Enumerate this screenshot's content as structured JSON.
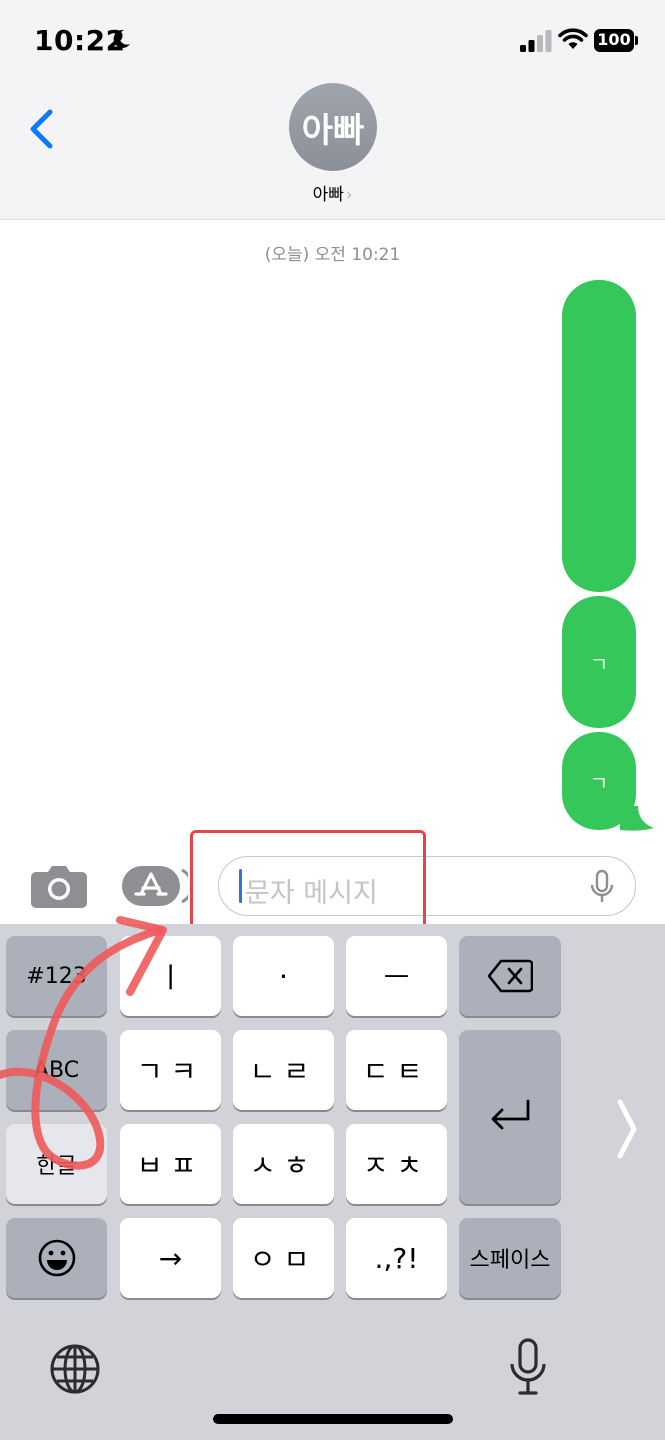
{
  "status_bar": {
    "time": "10:22",
    "battery": "100"
  },
  "header": {
    "avatar_text": "아빠",
    "contact_name": "아빠",
    "chevron": "›"
  },
  "conversation": {
    "timestamp": "(오늘) 오전 10:21",
    "messages": [
      {
        "text": "",
        "color": "#35c759"
      },
      {
        "text": "ㄱ",
        "color": "#35c759"
      },
      {
        "text": "ㄱ",
        "color": "#35c759"
      }
    ]
  },
  "input_bar": {
    "placeholder": "문자 메시지",
    "annotation_color": "#e24646"
  },
  "keyboard": {
    "row1": [
      "#123",
      "ㅣ",
      "·",
      "ㅡ"
    ],
    "row2": [
      "ABC",
      "ㄱㅋ",
      "ㄴㄹ",
      "ㄷㅌ"
    ],
    "row3": [
      "한글",
      "ㅂㅍ",
      "ㅅㅎ",
      "ㅈㅊ"
    ],
    "row4": [
      "→",
      "ㅇㅁ",
      ".,?!",
      "스페이스"
    ],
    "icons": [
      "emoji-icon",
      "delete-icon",
      "return-icon",
      "globe-icon",
      "mic-icon"
    ]
  },
  "colors": {
    "bubble": "#35c759",
    "accent": "#0a7aff",
    "keyboard_bg": "#d1d3d9"
  }
}
